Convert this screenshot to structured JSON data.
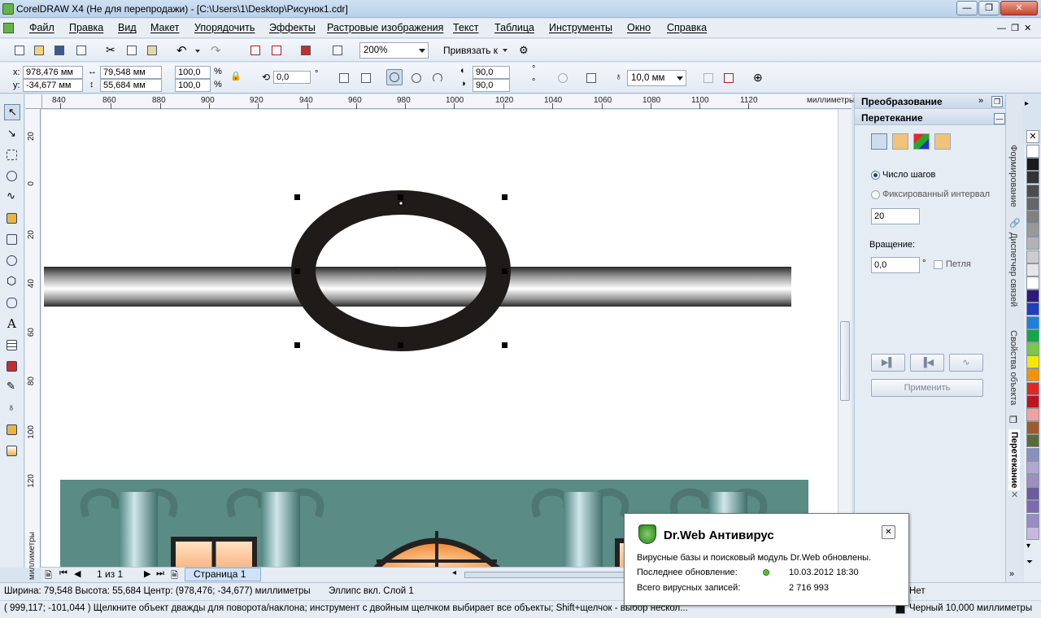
{
  "app": {
    "title": "CorelDRAW X4 (Не для перепродажи) - [C:\\Users\\1\\Desktop\\Рисунок1.cdr]",
    "window_controls": [
      "minimize",
      "restore",
      "close"
    ]
  },
  "menu": [
    "Файл",
    "Правка",
    "Вид",
    "Макет",
    "Упорядочить",
    "Эффекты",
    "Растровые изображения",
    "Текст",
    "Таблица",
    "Инструменты",
    "Окно",
    "Справка"
  ],
  "toolbar": {
    "zoom": "200%",
    "snap_label": "Привязать к"
  },
  "propertybar": {
    "x_label": "x:",
    "x_value": "978,476 мм",
    "y_label": "y:",
    "y_value": "-34,677 мм",
    "w_value": "79,548 мм",
    "h_value": "55,684 мм",
    "scale_x": "100,0",
    "scale_y": "100,0",
    "percent": "%",
    "rotation": "0,0",
    "degree": "°",
    "angle_start": "90,0",
    "angle_end": "90,0",
    "outline_width": "10,0 мм"
  },
  "ruler": {
    "h_ticks": [
      "840",
      "860",
      "880",
      "900",
      "920",
      "940",
      "960",
      "980",
      "1000",
      "1020",
      "1040",
      "1060",
      "1080",
      "1100",
      "1120"
    ],
    "h_unit": "миллиметры",
    "v_ticks": [
      "20",
      "0",
      "20",
      "40",
      "60",
      "80",
      "100",
      "120"
    ],
    "v_unit": "миллиметры"
  },
  "docker": {
    "title_transform": "Преобразование",
    "title_blend": "Перетекание",
    "steps_label": "Число шагов",
    "fixed_interval_label": "Фиксированный интервал",
    "steps_value": "20",
    "rotation_label": "Вращение:",
    "rotation_value": "0,0",
    "rotation_unit": "°",
    "loop_label": "Петля",
    "apply_label": "Применить"
  },
  "side_tabs": [
    "Формирование",
    "Диспетчер связей",
    "Свойства объекта",
    "Перетекание"
  ],
  "page_nav": {
    "counter": "1 из 1",
    "page_tab": "Страница 1"
  },
  "status": {
    "size_info": "Ширина: 79,548  Высота: 55,684  Центр: (978,476; -34,677)  миллиметры",
    "object_info": "Эллипс вкл. Слой 1",
    "hint": "( 999,117; -101,044 )   Щелкните объект дважды для поворота/наклона; инструмент с двойным щелчком выбирает все объекты; Shift+щелчок - выбор нескол...",
    "fill": "Нет",
    "outline": "Черный  10,000 миллиметры"
  },
  "notification": {
    "title": "Dr.Web Антивирус",
    "message": "Вирусные базы и поисковый модуль Dr.Web обновлены.",
    "last_update_label": "Последнее обновление:",
    "last_update_value": "10.03.2012 18:30",
    "records_label": "Всего вирусных записей:",
    "records_value": "2 716 993"
  },
  "palette_colors": [
    "#ffffff",
    "#1a1a1a",
    "#333333",
    "#4d4d4d",
    "#666666",
    "#808080",
    "#999999",
    "#b3b3b3",
    "#cccccc",
    "#e6e6e6",
    "#ffffff",
    "#2e1a7a",
    "#1f3fbf",
    "#1e7fe0",
    "#12a84a",
    "#7ac943",
    "#f7e600",
    "#f29400",
    "#e52620",
    "#c0141b",
    "#f2a0a0",
    "#a05a2c",
    "#5a6b3a",
    "#8a8fbf",
    "#b0a8d0",
    "#9f8fc0",
    "#6d5aa0",
    "#7d69b0",
    "#9a8cc8",
    "#c8b8e0"
  ]
}
